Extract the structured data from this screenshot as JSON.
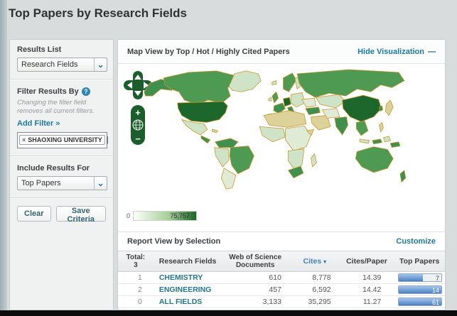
{
  "page_title": "Top Papers by Research Fields",
  "icons": {
    "help": "?",
    "chevron_down": "⌄",
    "minus": "—",
    "close": "×",
    "caret": "|",
    "sort_down": "▾"
  },
  "sidebar": {
    "results_list_label": "Results List",
    "results_list_value": "Research Fields",
    "filter_by_label": "Filter Results By",
    "filter_note": "Changing the filter field removes all current filters.",
    "add_filter_label": "Add Filter »",
    "filter_tag": "SHAOXING UNIVERSITY",
    "include_label": "Include Results For",
    "include_value": "Top Papers",
    "clear_label": "Clear",
    "save_label": "Save Criteria"
  },
  "map": {
    "header": "Map View by Top / Hot / Highly Cited Papers",
    "hide_label": "Hide Visualization",
    "legend_min": "0",
    "legend_max": "75,757"
  },
  "report": {
    "header": "Report View by Selection",
    "customize_label": "Customize",
    "total_label": "Total:",
    "total_count": "3",
    "columns": [
      "Research Fields",
      "Web of Science Documents",
      "Cites",
      "Cites/Paper",
      "Top Papers"
    ],
    "rows": [
      {
        "rank": "1",
        "field": "CHEMISTRY",
        "docs": "610",
        "cites": "8,778",
        "cites_per_paper": "14.39",
        "top_papers": "7",
        "bar_pct": 57
      },
      {
        "rank": "2",
        "field": "ENGINEERING",
        "docs": "457",
        "cites": "6,592",
        "cites_per_paper": "14.42",
        "top_papers": "14",
        "bar_pct": 100
      },
      {
        "rank": "0",
        "field": "ALL FIELDS",
        "docs": "3,133",
        "cites": "35,295",
        "cites_per_paper": "11.27",
        "top_papers": "61",
        "bar_pct": 100
      }
    ]
  },
  "colors": {
    "link_blue": "#1b7aa5",
    "bar_blue": "#4a7fc0",
    "map_green_dark": "#1d672c",
    "map_green_mid": "#4e9a52",
    "map_green_pale": "#cfe3c6",
    "map_border_tan": "#c9982f",
    "legend_green": "#186527"
  }
}
